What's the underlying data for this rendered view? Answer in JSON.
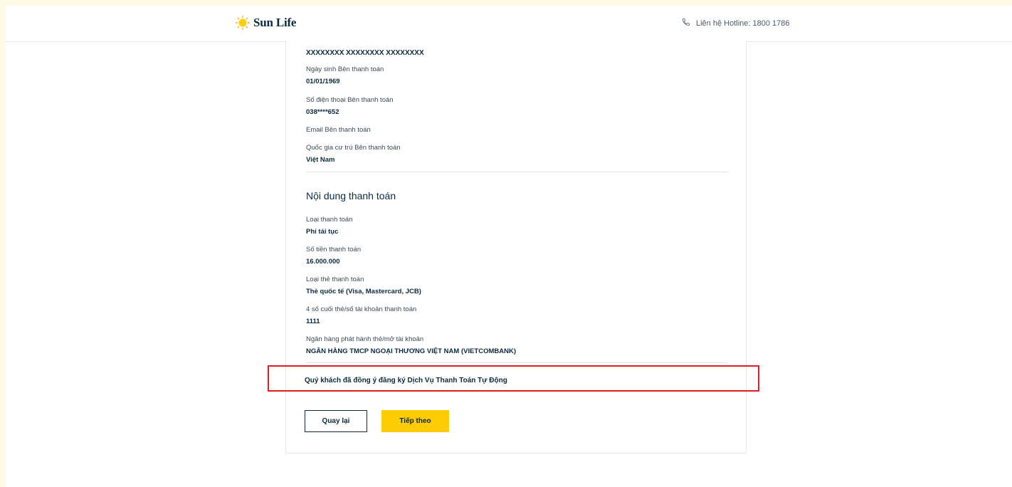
{
  "header": {
    "logo_text": "Sun Life",
    "hotline": "Liên hệ Hotline: 1800 1786"
  },
  "payer": {
    "name_value": "XXXXXXXX XXXXXXXX XXXXXXXX",
    "dob_label": "Ngày sinh Bên thanh toán",
    "dob_value": "01/01/1969",
    "phone_label": "Số điện thoại Bên thanh toán",
    "phone_value": "038****652",
    "email_label": "Email Bên thanh toán",
    "country_label": "Quốc gia cư trú Bên thanh toán",
    "country_value": "Việt Nam"
  },
  "payment": {
    "section_title": "Nội dung thanh toán",
    "type_label": "Loại thanh toán",
    "type_value": "Phí tái tục",
    "amount_label": "Số tiền thanh toán",
    "amount_value": "16.000.000",
    "card_type_label": "Loại thẻ thanh toán",
    "card_type_value": "Thẻ quốc tế (Visa, Mastercard, JCB)",
    "last4_label": "4 số cuối thẻ/số tài khoản thanh toán",
    "last4_value": "1111",
    "bank_label": "Ngân hàng phát hành thẻ/mở tài khoản",
    "bank_value": "NGÂN HÀNG TMCP NGOẠI THƯƠNG VIỆT NAM (VIETCOMBANK)"
  },
  "agreement_text": "Quý khách đã đồng ý đăng ký Dịch Vụ Thanh Toán Tự Động",
  "buttons": {
    "back": "Quay lại",
    "next": "Tiếp theo"
  },
  "colors": {
    "background": "#fef9e5",
    "brand_navy": "#0b2a3d",
    "brand_yellow": "#ffcb05",
    "highlight_red": "#e31b23"
  },
  "icons": {
    "logo": "sun-logo-icon",
    "phone": "phone-icon"
  }
}
